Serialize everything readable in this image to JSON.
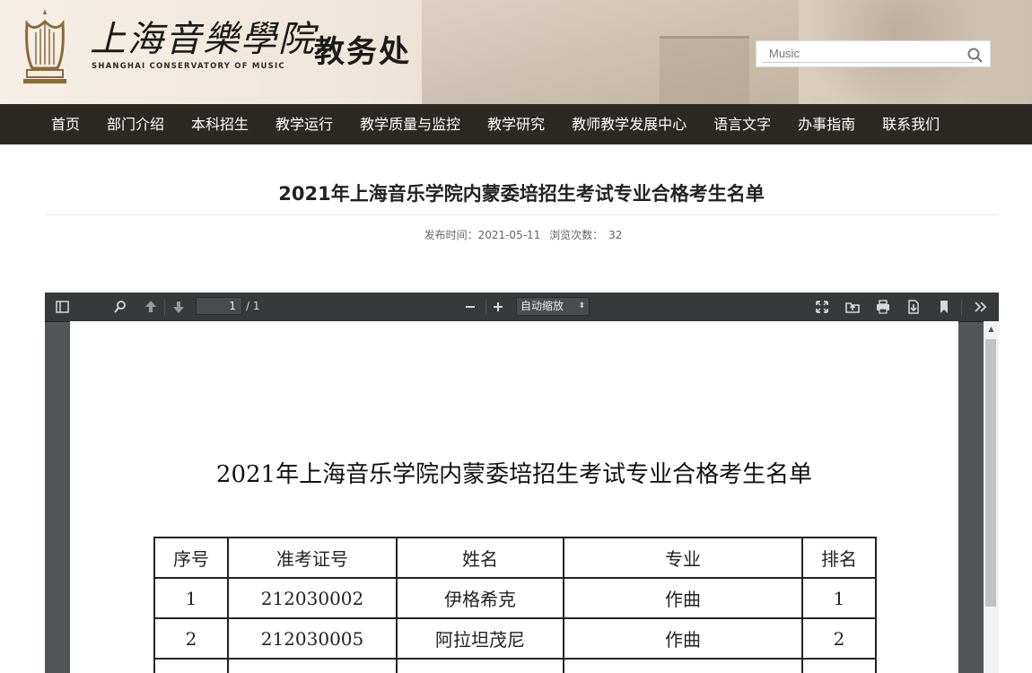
{
  "header": {
    "logo_cn": "上海音樂學院",
    "logo_en": "SHANGHAI CONSERVATORY OF MUSIC",
    "office": "教务处",
    "search_placeholder": "Music"
  },
  "nav": {
    "items": [
      "首页",
      "部门介绍",
      "本科招生",
      "教学运行",
      "教学质量与监控",
      "教学研究",
      "教师教学发展中心",
      "语言文字",
      "办事指南",
      "联系我们"
    ]
  },
  "article": {
    "title": "2021年上海音乐学院内蒙委培招生考试专业合格考生名单",
    "publish_label": "发布时间：2021-05-11",
    "views_label": "浏览次数：",
    "views": "32"
  },
  "viewer": {
    "page_current": "1",
    "page_total": "/ 1",
    "zoom": "自动缩放",
    "icons": [
      "sidebar-toggle-icon",
      "search-icon",
      "previous-page-icon",
      "next-page-icon",
      "zoom-out-icon",
      "zoom-in-icon",
      "presentation-mode-icon",
      "open-file-icon",
      "print-icon",
      "download-icon",
      "bookmark-icon",
      "tools-icon"
    ]
  },
  "pdf": {
    "title": "2021年上海音乐学院内蒙委培招生考试专业合格考生名单",
    "headers": [
      "序号",
      "准考证号",
      "姓名",
      "专业",
      "排名"
    ],
    "rows": [
      [
        "1",
        "212030002",
        "伊格希克",
        "作曲",
        "1"
      ],
      [
        "2",
        "212030005",
        "阿拉坦茂尼",
        "作曲",
        "2"
      ]
    ]
  },
  "colors": {
    "nav_bg": "#2c2925",
    "toolbar_bg": "#38393b",
    "viewer_bg": "#525659"
  }
}
